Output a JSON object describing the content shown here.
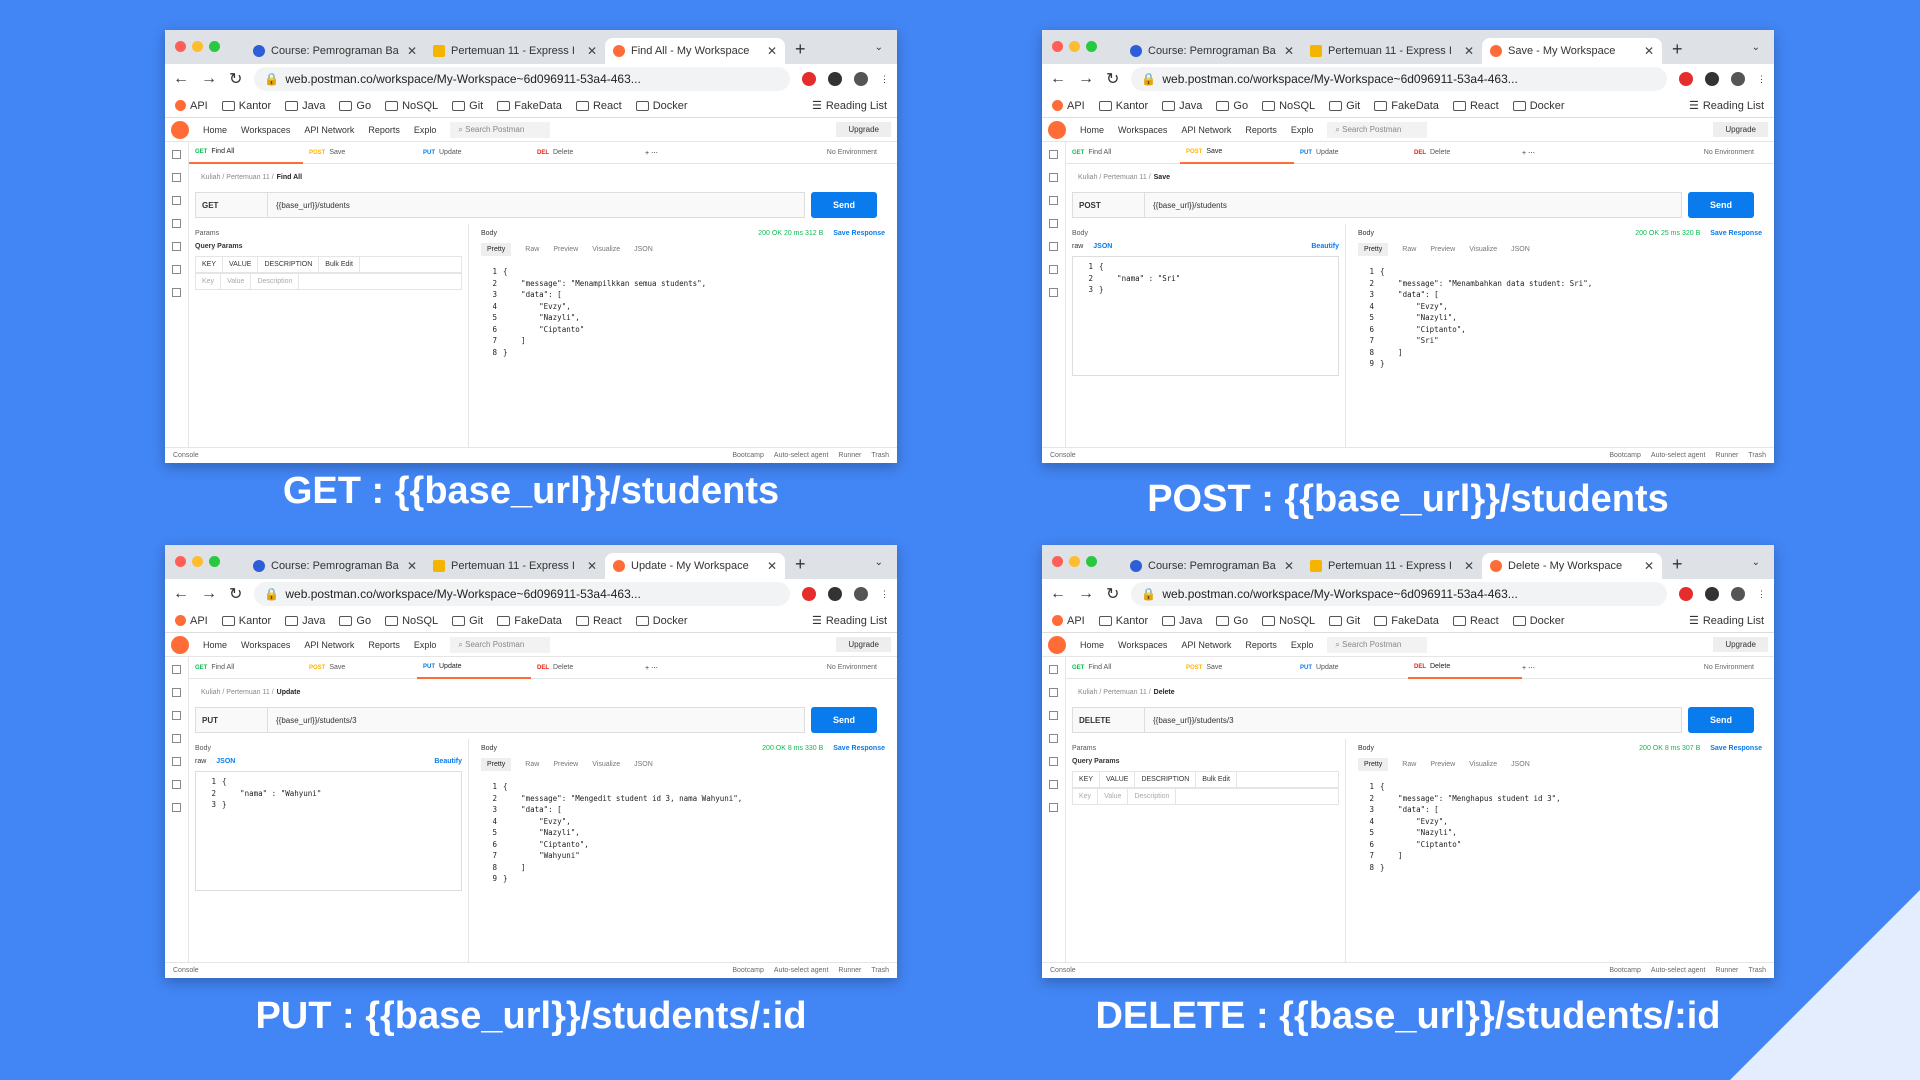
{
  "browser": {
    "tabs_common": [
      "Course: Pemrograman Ba",
      "Pertemuan 11 - Express I"
    ],
    "url": "web.postman.co/workspace/My-Workspace~6d096911-53a4-463...",
    "bookmarks": [
      "API",
      "Kantor",
      "Java",
      "Go",
      "NoSQL",
      "Git",
      "FakeData",
      "React",
      "Docker"
    ],
    "reading_list": "Reading List"
  },
  "postman": {
    "nav": [
      "Home",
      "Workspaces",
      "API Network",
      "Reports",
      "Explo"
    ],
    "search": "Search Postman",
    "upgrade": "Upgrade",
    "env": "No Environment",
    "send": "Send",
    "console": "Console",
    "footer_right": [
      "Bootcamp",
      "Auto-select agent",
      "Runner",
      "Trash"
    ],
    "req_tabs": [
      {
        "method": "GET",
        "label": "Find All"
      },
      {
        "method": "POST",
        "label": "Save"
      },
      {
        "method": "PUT",
        "label": "Update"
      },
      {
        "method": "DEL",
        "label": "Delete"
      }
    ],
    "body_tabs": [
      "Pretty",
      "Raw",
      "Preview",
      "Visualize",
      "JSON"
    ],
    "save_response": "Save Response",
    "params": "Params",
    "body": "Body",
    "query_params": "Query Params",
    "kv_headers": [
      "KEY",
      "VALUE",
      "DESCRIPTION",
      "Bulk Edit"
    ],
    "kv_placeholder": [
      "Key",
      "Value",
      "Description"
    ],
    "raw": "raw",
    "json": "JSON",
    "beautify": "Beautify"
  },
  "panels": [
    {
      "tab_title": "Find All - My Workspace",
      "crumb": "Kuliah / Pertemuan 11 /",
      "crumb_b": "Find All",
      "method": "GET",
      "url": "{{base_url}}/students",
      "status": "200 OK  20 ms  312 B",
      "code": "{\n    \"message\": \"Menampilkkan semua students\",\n    \"data\": [\n        \"Evzy\",\n        \"Nazyli\",\n        \"Ciptanto\"\n    ]\n}",
      "lines": "1\n2\n3\n4\n5\n6\n7\n8",
      "caption": "GET : {{base_url}}/students"
    },
    {
      "tab_title": "Save - My Workspace",
      "crumb": "Kuliah / Pertemuan 11 /",
      "crumb_b": "Save",
      "method": "POST",
      "url": "{{base_url}}/students",
      "status": "200 OK  25 ms  320 B",
      "reqbody": "{\n    \"nama\" : \"Sri\"\n}",
      "reqlines": "1\n2\n3",
      "code": "{\n    \"message\": \"Menambahkan data student: Sri\",\n    \"data\": [\n        \"Evzy\",\n        \"Nazyli\",\n        \"Ciptanto\",\n        \"Sri\"\n    ]\n}",
      "lines": "1\n2\n3\n4\n5\n6\n7\n8\n9",
      "caption": "POST : {{base_url}}/students"
    },
    {
      "tab_title": "Update - My Workspace",
      "crumb": "Kuliah / Pertemuan 11 /",
      "crumb_b": "Update",
      "method": "PUT",
      "url": "{{base_url}}/students/3",
      "status": "200 OK  8 ms  330 B",
      "reqbody": "{\n    \"nama\" : \"Wahyuni\"\n}",
      "reqlines": "1\n2\n3",
      "code": "{\n    \"message\": \"Mengedit student id 3, nama Wahyuni\",\n    \"data\": [\n        \"Evzy\",\n        \"Nazyli\",\n        \"Ciptanto\",\n        \"Wahyuni\"\n    ]\n}",
      "lines": "1\n2\n3\n4\n5\n6\n7\n8\n9",
      "caption": "PUT : {{base_url}}/students/:id"
    },
    {
      "tab_title": "Delete - My Workspace",
      "crumb": "Kuliah / Pertemuan 11 /",
      "crumb_b": "Delete",
      "method": "DELETE",
      "url": "{{base_url}}/students/3",
      "status": "200 OK  8 ms  307 B",
      "code": "{\n    \"message\": \"Menghapus student id 3\",\n    \"data\": [\n        \"Evzy\",\n        \"Nazyli\",\n        \"Ciptanto\"\n    ]\n}",
      "lines": "1\n2\n3\n4\n5\n6\n7\n8",
      "caption": "DELETE : {{base_url}}/students/:id"
    }
  ]
}
